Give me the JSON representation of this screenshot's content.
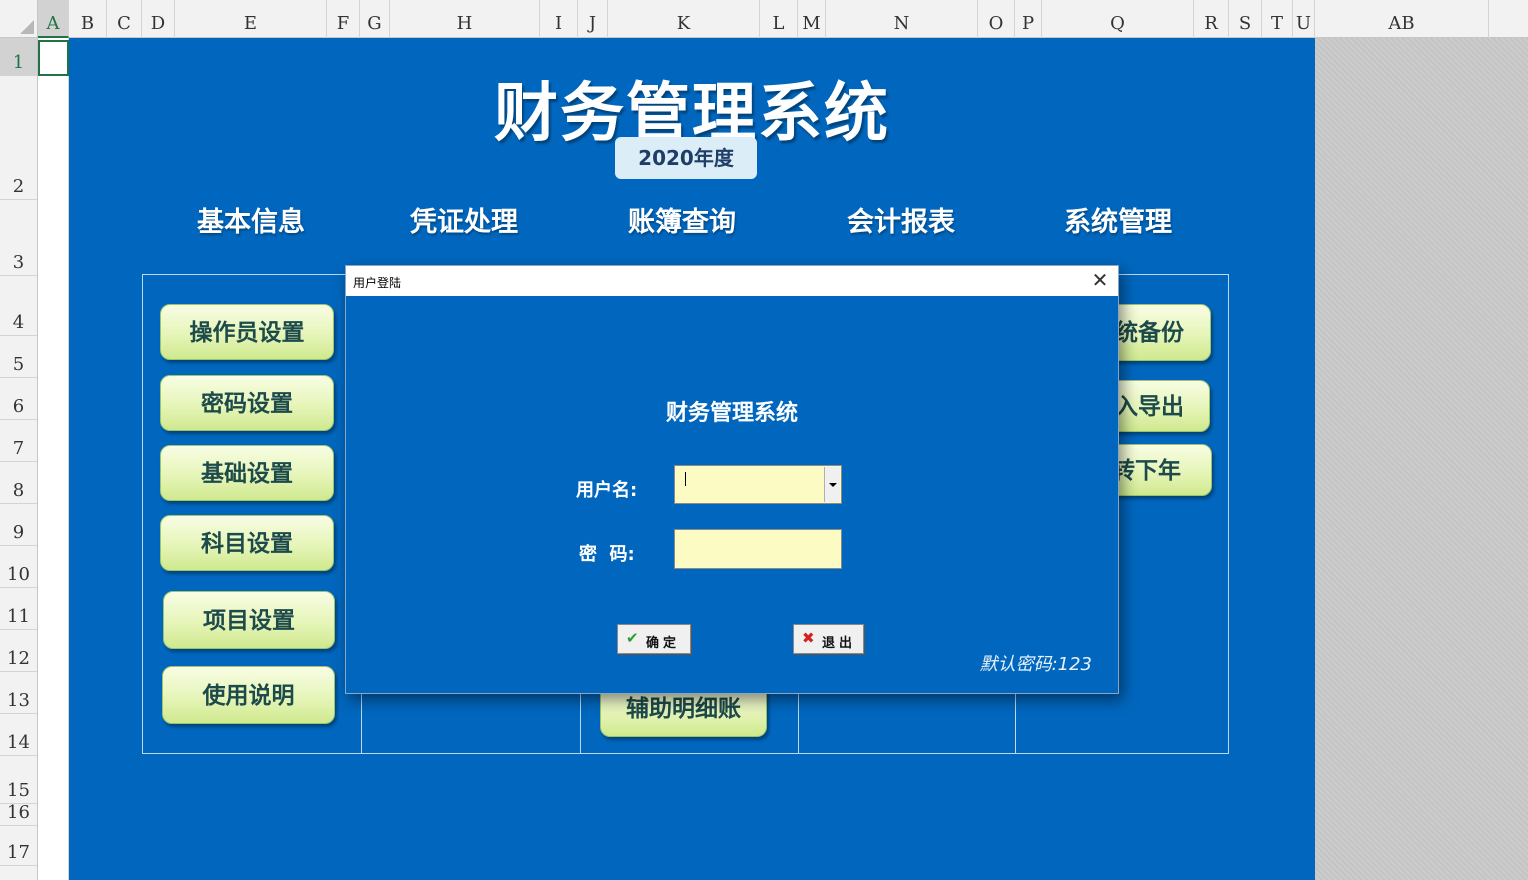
{
  "spreadsheet": {
    "columns": [
      "A",
      "B",
      "C",
      "D",
      "E",
      "F",
      "G",
      "H",
      "I",
      "J",
      "K",
      "L",
      "M",
      "N",
      "O",
      "P",
      "Q",
      "R",
      "S",
      "T",
      "U",
      "AB"
    ],
    "rows": [
      "1",
      "2",
      "3",
      "4",
      "5",
      "6",
      "7",
      "8",
      "9",
      "10",
      "11",
      "12",
      "13",
      "14",
      "15",
      "16",
      "17"
    ],
    "selected_cell": "A1"
  },
  "dashboard": {
    "title": "财务管理系统",
    "year": "2020年度",
    "categories": [
      "基本信息",
      "凭证处理",
      "账簿查询",
      "会计报表",
      "系统管理"
    ],
    "basic_buttons": [
      "操作员设置",
      "密码设置",
      "基础设置",
      "科目设置",
      "项目设置",
      "使用说明"
    ],
    "voucher_partial_button": "辅助明细账",
    "system_buttons_visible": [
      "统备份",
      "入导出",
      "转下年"
    ]
  },
  "dialog": {
    "title": "用户登陆",
    "close_glyph": "✕",
    "heading": "财务管理系统",
    "username_label": "用户名:",
    "username_value": "",
    "password_label": "密  码:",
    "password_value": "",
    "ok_icon": "✔",
    "ok_label": "确定",
    "exit_icon": "✖",
    "exit_label": "退出",
    "hint": "默认密码:123"
  },
  "colors": {
    "dashboard_bg": "#0167be",
    "button_fill": "#e6f5b8",
    "field_bg": "#fdfbc4",
    "excel_green": "#217346"
  }
}
